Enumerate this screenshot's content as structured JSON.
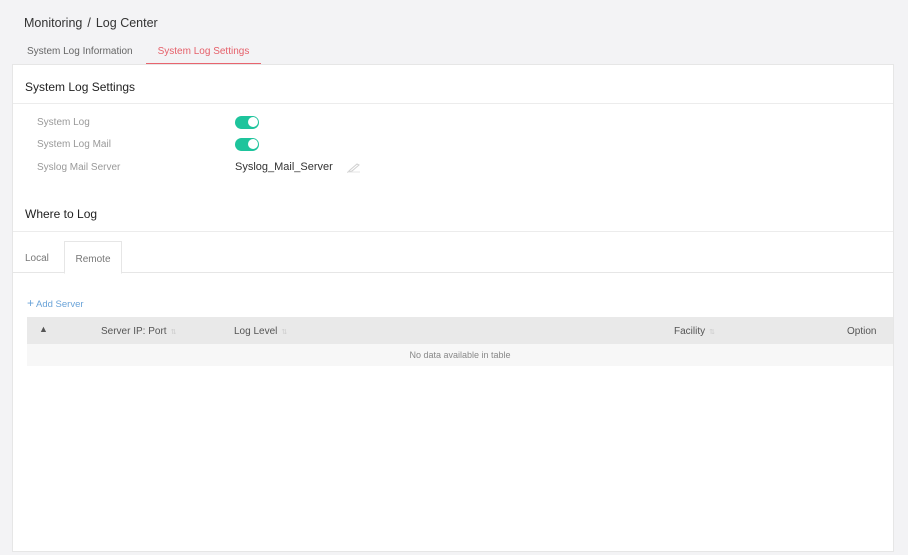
{
  "breadcrumb": {
    "parent": "Monitoring",
    "separator": "/",
    "current": "Log Center"
  },
  "top_tabs": [
    {
      "label": "System Log Information",
      "active": false
    },
    {
      "label": "System Log Settings",
      "active": true
    }
  ],
  "settings_section": {
    "title": "System Log Settings",
    "rows": [
      {
        "label": "System Log",
        "type": "toggle",
        "on": true
      },
      {
        "label": "System Log Mail",
        "type": "toggle",
        "on": true
      },
      {
        "label": "Syslog Mail Server",
        "type": "text",
        "value": "Syslog_Mail_Server",
        "icon": "edit-icon"
      }
    ]
  },
  "where_section": {
    "title": "Where to Log",
    "tabs": [
      {
        "label": "Local",
        "active": false
      },
      {
        "label": "Remote",
        "active": true
      }
    ],
    "add_server_label": "Add Server",
    "table": {
      "columns": [
        "Server IP: Port",
        "Log Level",
        "Facility",
        "Option"
      ],
      "empty_text": "No data available in table"
    }
  },
  "colors": {
    "accent_tab": "#e8646e",
    "toggle_on": "#1ec49c",
    "link": "#6aa3d8"
  }
}
